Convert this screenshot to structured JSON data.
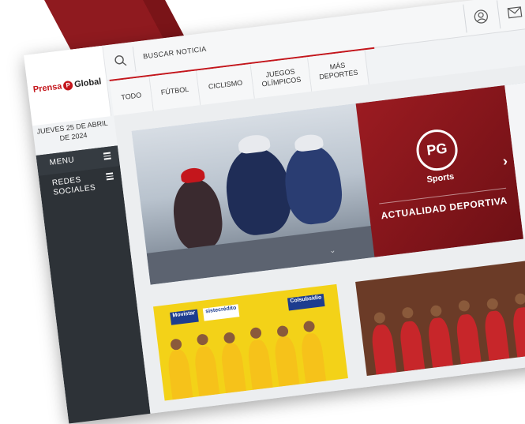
{
  "header": {
    "logo": {
      "part1": "Prensa",
      "part2": "Global",
      "mark": "P"
    },
    "search_label": "BUSCAR NOTICIA",
    "icons": {
      "search": "search-icon",
      "user": "user-icon",
      "mail": "mail-icon"
    }
  },
  "nav": {
    "items": [
      {
        "label": "TODO"
      },
      {
        "label": "FÚTBOL"
      },
      {
        "label": "CICLISMO"
      },
      {
        "label": "JUEGOS OLÍMPICOS"
      },
      {
        "label": "MÁS DEPORTES"
      }
    ]
  },
  "date": "JUEVES 25 DE ABRIL DE 2024",
  "sidebar": {
    "items": [
      {
        "label": "MENU"
      },
      {
        "label": "REDES SOCIALES"
      }
    ]
  },
  "hero": {
    "logo_text": "PG",
    "brand": "Sports",
    "tagline": "ACTUALIDAD DEPORTIVA"
  },
  "cards": {
    "sponsors": [
      "Movistar",
      "sistecrédito",
      "Colsubsidio"
    ]
  },
  "colors": {
    "accent": "#c4161c",
    "sidebar": "#2d3237",
    "hero_panel": "#8f1a1f"
  }
}
